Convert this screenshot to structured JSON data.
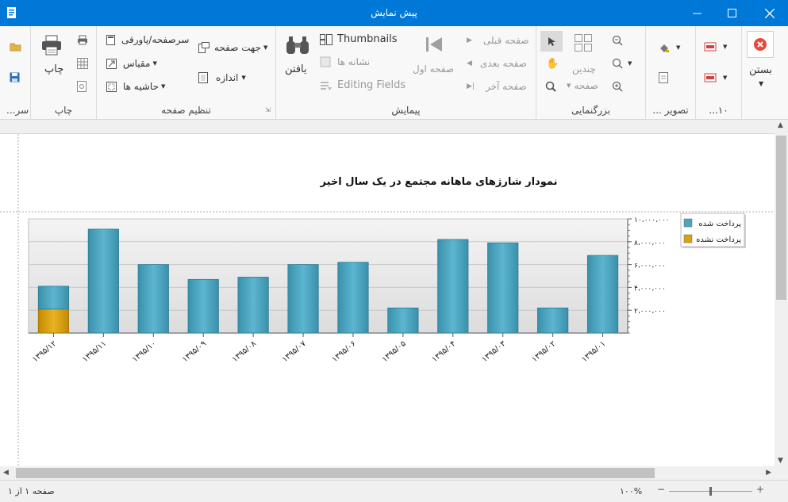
{
  "window": {
    "title": "پیش نمایش"
  },
  "ribbon": {
    "close_group": {
      "close_label": "بستن"
    },
    "group_1000": {
      "label": "...۱۰"
    },
    "image_group": {
      "label": "... تصویر"
    },
    "zoom_group": {
      "label": "بزرگنمایی",
      "multi_page_label": "چندین",
      "page_label": "صفحه"
    },
    "nav_group": {
      "label": "پیمایش",
      "first_page": "صفحه اول",
      "prev_page": "صفحه قبلی",
      "next_page": "صفحه بعدی",
      "last_page": "صفحه آخر",
      "thumbnails": "Thumbnails",
      "bookmarks": "نشانه ها",
      "editing_fields": "Editing Fields",
      "find": "یافتن"
    },
    "page_setup_group": {
      "label": "تنظیم صفحه",
      "header_footer": "سرصفحه/پاورقی",
      "scale": "مقیاس",
      "margins": "حاشیه ها",
      "orientation": "جهت صفحه",
      "size": "اندازه"
    },
    "print_group": {
      "label": "چاپ",
      "print": "چاپ"
    },
    "doc_group": {
      "label": "...سر"
    }
  },
  "report": {
    "title": "نمودار شارژهای ماهانه مجتمع در یک سال اخیر"
  },
  "chart_data": {
    "type": "bar",
    "stacked": true,
    "categories": [
      "۱۳۹۵/۰۱",
      "۱۳۹۵/۰۲",
      "۱۳۹۵/۰۳",
      "۱۳۹۵/۰۴",
      "۱۳۹۵/۰۵",
      "۱۳۹۵/۰۶",
      "۱۳۹۵/۰۷",
      "۱۳۹۵/۰۸",
      "۱۳۹۵/۰۹",
      "۱۳۹۵/۱۰",
      "۱۳۹۵/۱۱",
      "۱۳۹۵/۱۲"
    ],
    "series": [
      {
        "name": "پرداخت شده",
        "color": "#4ba6c0",
        "values": [
          6800000,
          2200000,
          7900000,
          8200000,
          2200000,
          6200000,
          6000000,
          4900000,
          4700000,
          6000000,
          9100000,
          2000000
        ]
      },
      {
        "name": "پرداخت نشده",
        "color": "#d9a20e",
        "values": [
          0,
          0,
          0,
          0,
          0,
          0,
          0,
          0,
          0,
          0,
          0,
          2100000
        ]
      }
    ],
    "y_ticks": [
      "۲،۰۰۰،۰۰۰",
      "۴،۰۰۰،۰۰۰",
      "۶،۰۰۰،۰۰۰",
      "۸،۰۰۰،۰۰۰",
      "۱۰،۰۰۰،۰۰۰"
    ],
    "y_tick_values": [
      2000000,
      4000000,
      6000000,
      8000000,
      10000000
    ],
    "ylim": [
      0,
      10000000
    ],
    "y_axis_side": "right",
    "legend_position": "top-right"
  },
  "status": {
    "page_info": "صفحه ۱ از ۱",
    "zoom": "۱۰۰%"
  }
}
